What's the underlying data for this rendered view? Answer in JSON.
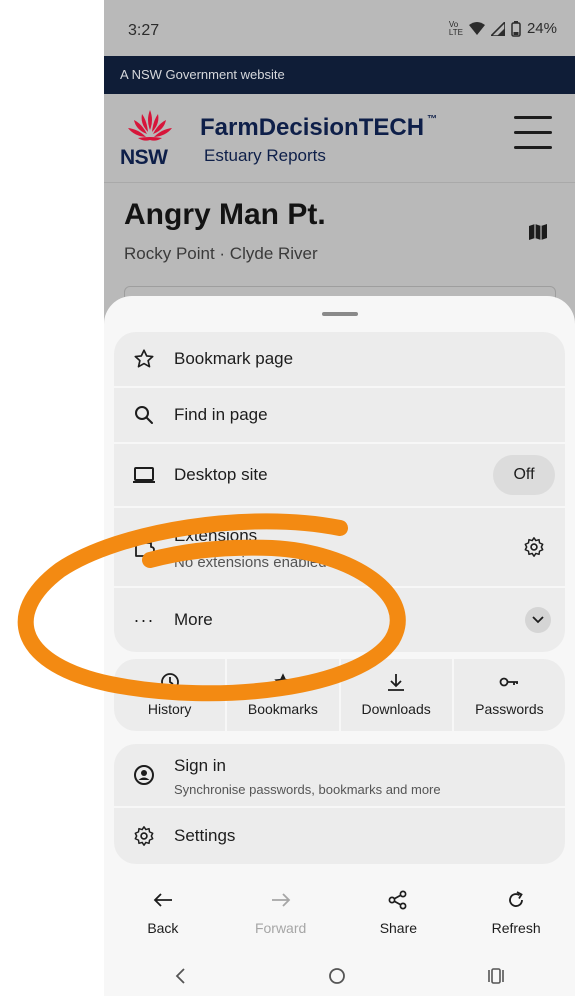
{
  "status": {
    "time": "3:27",
    "battery": "24%",
    "network_tag": "Vo) LTE"
  },
  "site": {
    "gov_banner": "A NSW Government website",
    "logo_text": "NSW",
    "brand": "FarmDecisionTECH",
    "brand_tm": "™",
    "brand_sub": "Estuary Reports",
    "place_title": "Angry Man Pt.",
    "place_sub": "Rocky Point · Clyde River"
  },
  "menu": {
    "bookmark": "Bookmark page",
    "find": "Find in page",
    "desktop": "Desktop site",
    "desktop_state": "Off",
    "extensions": "Extensions",
    "extensions_sub": "No extensions enabled",
    "more": "More",
    "quick": [
      {
        "label": "History",
        "icon": "history-icon"
      },
      {
        "label": "Bookmarks",
        "icon": "bookmarks-icon"
      },
      {
        "label": "Downloads",
        "icon": "downloads-icon"
      },
      {
        "label": "Passwords",
        "icon": "key-icon"
      }
    ],
    "signin": "Sign in",
    "signin_sub": "Synchronise passwords, bookmarks and more",
    "settings": "Settings"
  },
  "bottom_nav": [
    {
      "label": "Back",
      "icon": "arrow-left-icon",
      "enabled": true
    },
    {
      "label": "Forward",
      "icon": "arrow-right-icon",
      "enabled": false
    },
    {
      "label": "Share",
      "icon": "share-icon",
      "enabled": true
    },
    {
      "label": "Refresh",
      "icon": "refresh-icon",
      "enabled": true
    }
  ],
  "colors": {
    "accent_annotation": "#f38a12",
    "gov_strip": "#0f1d37",
    "waratah": "#d7153a"
  }
}
